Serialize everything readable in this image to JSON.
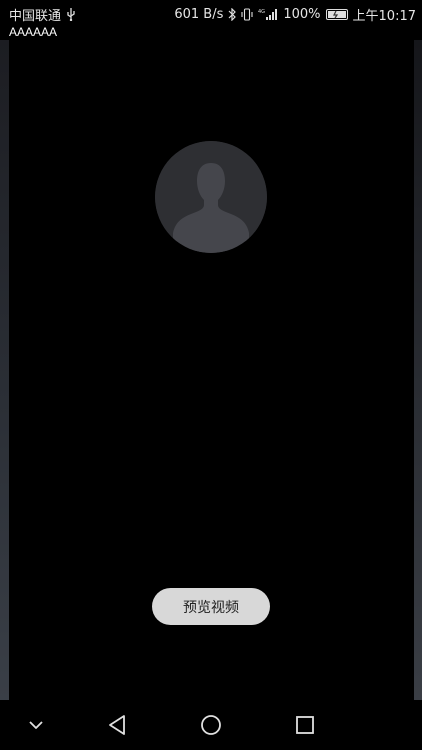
{
  "status_bar": {
    "carrier": "中国联通",
    "net_speed": "601 B/s",
    "signal_type": "4G",
    "battery_percent": "100%",
    "battery_level": 1.0,
    "time": "上午10:17"
  },
  "app": {
    "label": "AAAAAA"
  },
  "avatar": {
    "icon": "person-silhouette-icon"
  },
  "actions": {
    "preview_label": "预览视频"
  },
  "nav_bar": {
    "items": [
      "collapse",
      "back",
      "home",
      "recents"
    ]
  },
  "colors": {
    "background": "#000000",
    "avatar_bg": "#2e2f33",
    "avatar_figure": "#45464c",
    "button_bg": "#d8d8d8",
    "button_text": "#222222"
  }
}
